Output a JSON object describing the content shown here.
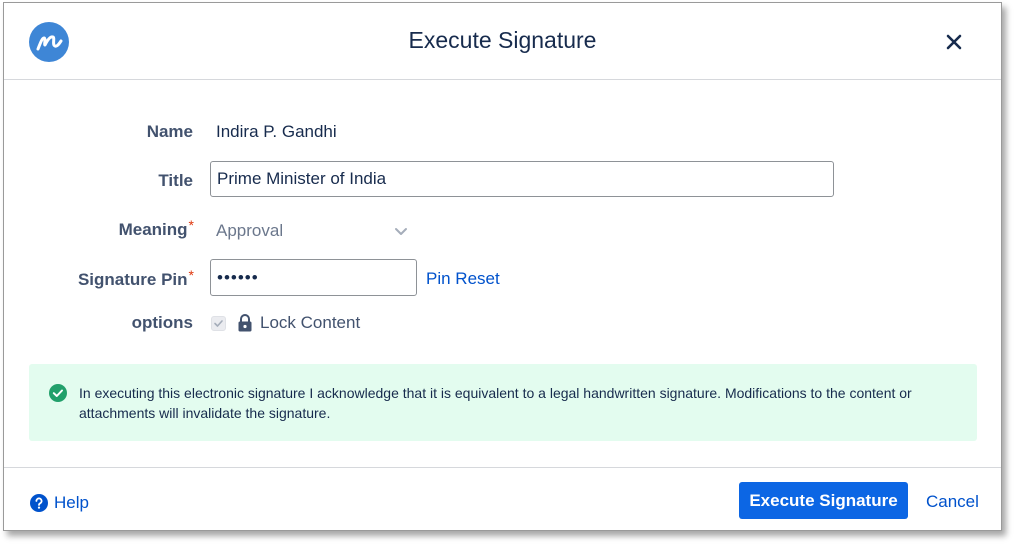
{
  "dialog": {
    "title": "Execute Signature",
    "logo_icon": "brand-n-logo",
    "close_icon": "close-icon"
  },
  "form": {
    "name": {
      "label": "Name",
      "value": "Indira P. Gandhi"
    },
    "title": {
      "label": "Title",
      "value": "Prime Minister of India"
    },
    "meaning": {
      "label": "Meaning",
      "required_mark": "*",
      "value": "Approval"
    },
    "signature_pin": {
      "label": "Signature Pin",
      "required_mark": "*",
      "value": "••••••"
    },
    "pin_reset_label": "Pin Reset",
    "options": {
      "label": "options",
      "checkbox_checked": true,
      "lock_label": "Lock Content"
    }
  },
  "notice": {
    "text": "In executing this electronic signature I acknowledge that it is equivalent to a legal handwritten signature. Modifications to the content or attachments will invalidate the signature."
  },
  "footer": {
    "help_label": "Help",
    "execute_label": "Execute Signature",
    "cancel_label": "Cancel"
  },
  "colors": {
    "accent": "#0c66e4",
    "link": "#0052cc",
    "success_bg": "#e3fcef",
    "success_icon": "#22a06b",
    "required": "#de350b"
  }
}
